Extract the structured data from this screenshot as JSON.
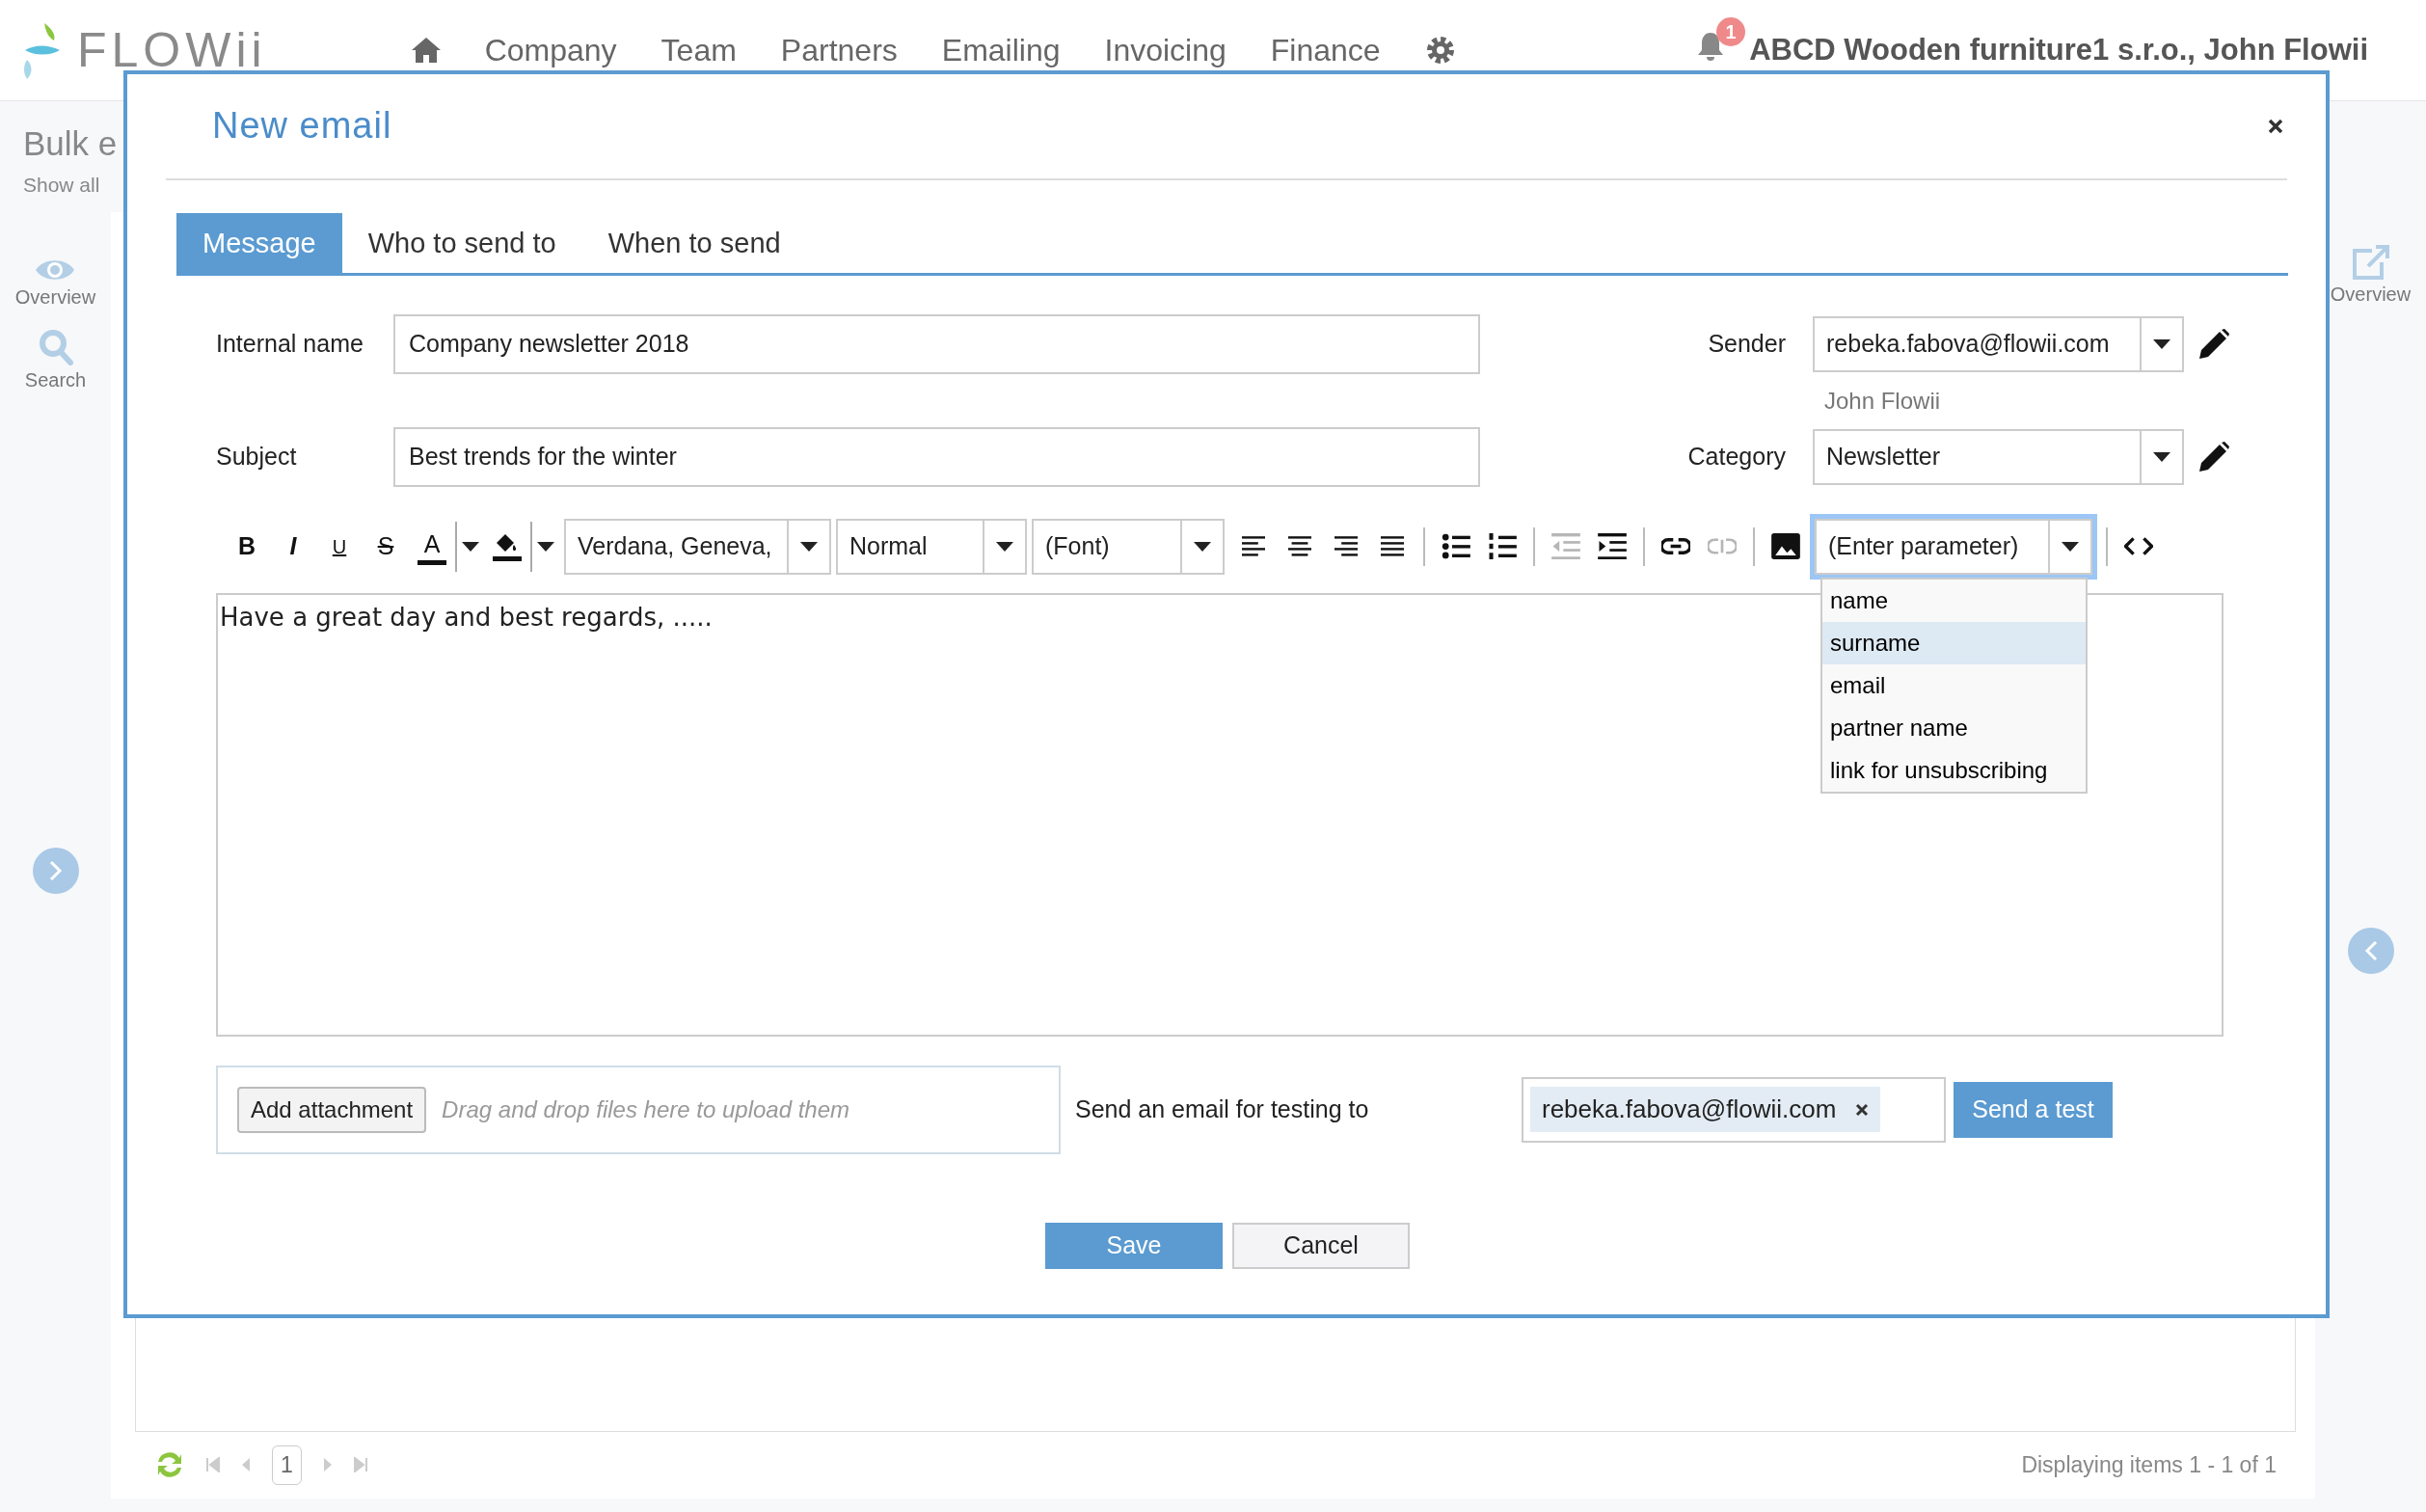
{
  "brand": {
    "name": "FLOWii"
  },
  "nav": {
    "items": [
      "Company",
      "Team",
      "Partners",
      "Emailing",
      "Invoicing",
      "Finance"
    ]
  },
  "notifications": {
    "count": "1"
  },
  "account": "ABCD Wooden furniture1 s.r.o., John Flowii",
  "page": {
    "title": "Bulk e",
    "subtitle": "Show all"
  },
  "left_sidebar": {
    "items": [
      {
        "label": "Overview",
        "kind": "eye"
      },
      {
        "label": "Search",
        "kind": "search"
      }
    ]
  },
  "right_sidebar": {
    "items": [
      {
        "label": "Overview",
        "kind": "external"
      }
    ]
  },
  "grid_footer": {
    "page": "1",
    "summary": "Displaying items 1 - 1 of 1"
  },
  "modal": {
    "title": "New email",
    "tabs": [
      {
        "label": "Message",
        "selected": true
      },
      {
        "label": "Who to send to",
        "selected": false
      },
      {
        "label": "When to send",
        "selected": false
      }
    ],
    "internal_name": {
      "label": "Internal name",
      "value": "Company newsletter 2018"
    },
    "subject": {
      "label": "Subject",
      "value": "Best trends for the winter"
    },
    "sender": {
      "label": "Sender",
      "value": "rebeka.fabova@flowii.com",
      "note": "John Flowii"
    },
    "category": {
      "label": "Category",
      "value": "Newsletter"
    },
    "toolbar": [
      {
        "kind": "bold",
        "label": "B",
        "disabled": false
      },
      {
        "kind": "italic",
        "label": "I",
        "disabled": false
      },
      {
        "kind": "underline",
        "label": "U",
        "disabled": false
      },
      {
        "kind": "strike",
        "label": "S",
        "disabled": false
      },
      {
        "kind": "color",
        "label": "A",
        "disabled": false
      },
      {
        "kind": "fill",
        "disabled": false
      },
      {
        "kind": "select",
        "value": "Verdana, Geneva,"
      },
      {
        "kind": "select",
        "value": "Normal"
      },
      {
        "kind": "select",
        "value": "(Font)"
      },
      {
        "kind": "align-left",
        "disabled": false
      },
      {
        "kind": "align-center",
        "disabled": false
      },
      {
        "kind": "align-right",
        "disabled": false
      },
      {
        "kind": "justify",
        "disabled": false
      },
      {
        "kind": "sep"
      },
      {
        "kind": "bullets",
        "disabled": false
      },
      {
        "kind": "numbers",
        "disabled": false
      },
      {
        "kind": "sep"
      },
      {
        "kind": "outdent",
        "disabled": true
      },
      {
        "kind": "indent",
        "disabled": false
      },
      {
        "kind": "sep"
      },
      {
        "kind": "link",
        "disabled": false
      },
      {
        "kind": "unlink",
        "disabled": true
      },
      {
        "kind": "sep"
      },
      {
        "kind": "image",
        "disabled": false
      },
      {
        "kind": "param"
      },
      {
        "kind": "sep"
      },
      {
        "kind": "code",
        "disabled": false
      }
    ],
    "parameter": {
      "value": "(Enter parameter)",
      "options": [
        {
          "label": "name",
          "selected": false
        },
        {
          "label": "surname",
          "selected": true
        },
        {
          "label": "email",
          "selected": false
        },
        {
          "label": "partner name",
          "selected": false
        },
        {
          "label": "link for unsubscribing",
          "selected": false
        }
      ]
    },
    "editor": {
      "text": "Have a great day and best regards, ....."
    },
    "attachment": {
      "button": "Add attachment",
      "placeholder": "Drag and drop files here to upload them"
    },
    "test_email": {
      "label": "Send an email for testing to",
      "recipients": [
        "rebeka.fabova@flowii.com"
      ],
      "button": "Send a test"
    },
    "save": "Save",
    "cancel": "Cancel"
  }
}
